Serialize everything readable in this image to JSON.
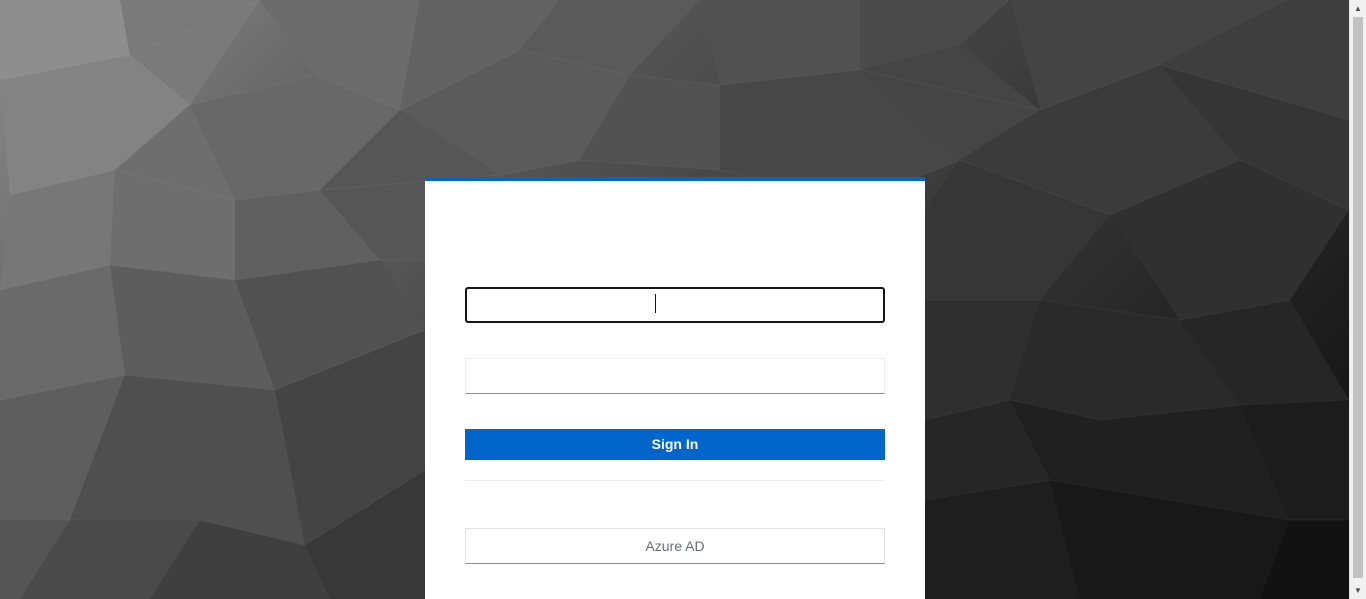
{
  "login": {
    "username_value": "",
    "password_value": "",
    "signin_label": "Sign In",
    "idp_azure_label": "Azure AD"
  },
  "scrollbar": {
    "up_icon": "▲",
    "down_icon": "▼"
  },
  "colors": {
    "accent": "#0066cc",
    "card_bg": "#ffffff",
    "idp_text": "#6a6e73"
  }
}
